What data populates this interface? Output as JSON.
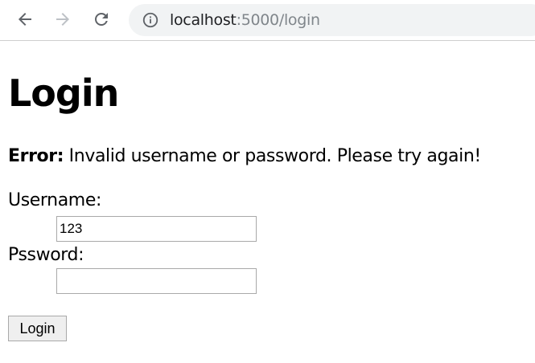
{
  "browser": {
    "url_host": "localhost",
    "url_path": ":5000/login",
    "icons": {
      "back": "back-arrow-icon",
      "forward": "forward-arrow-icon",
      "reload": "reload-icon",
      "site_info": "info-icon"
    }
  },
  "page": {
    "title": "Login",
    "error_label": "Error:",
    "error_text": " Invalid username or password. Please try again!",
    "username_label": "Username:",
    "username_value": "123",
    "password_label": "Pssword:",
    "password_value": "",
    "submit_label": "Login"
  }
}
